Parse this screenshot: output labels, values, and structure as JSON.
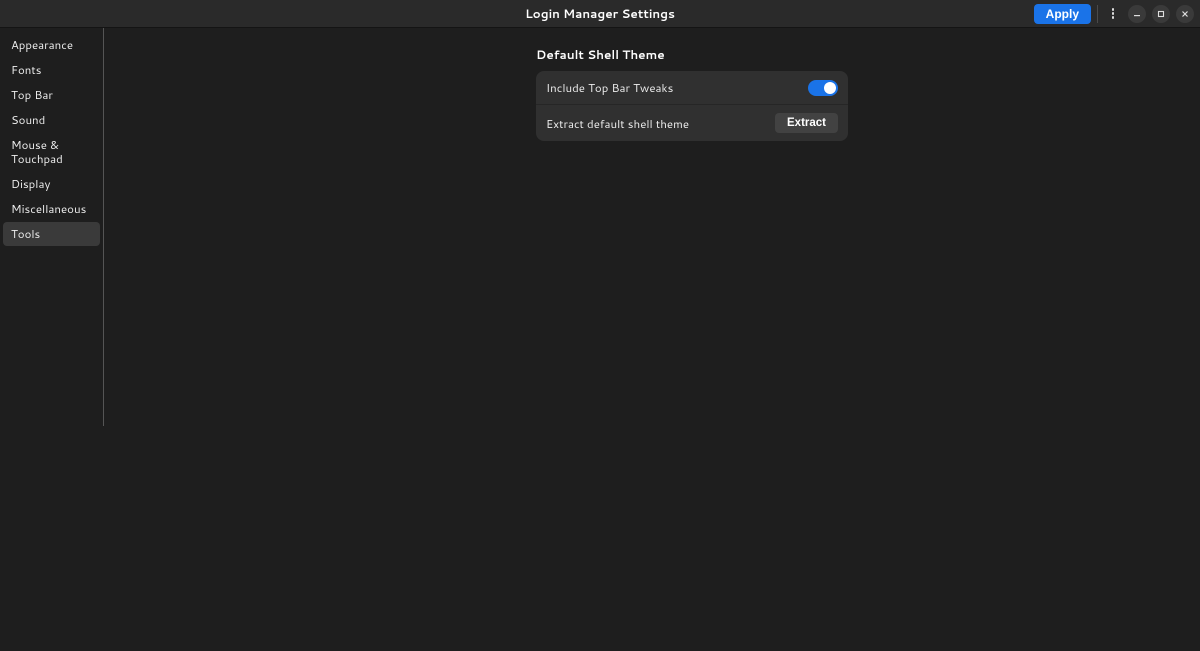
{
  "header": {
    "title": "Login Manager Settings",
    "apply_label": "Apply"
  },
  "sidebar": {
    "items": [
      {
        "label": "Appearance",
        "selected": false
      },
      {
        "label": "Fonts",
        "selected": false
      },
      {
        "label": "Top Bar",
        "selected": false
      },
      {
        "label": "Sound",
        "selected": false
      },
      {
        "label": "Mouse & Touchpad",
        "selected": false
      },
      {
        "label": "Display",
        "selected": false
      },
      {
        "label": "Miscellaneous",
        "selected": false
      },
      {
        "label": "Tools",
        "selected": true
      }
    ]
  },
  "main": {
    "section_title": "Default Shell Theme",
    "rows": {
      "include_top_bar_tweaks": {
        "label": "Include Top Bar Tweaks",
        "toggle_on": true
      },
      "extract_default": {
        "label": "Extract default shell theme",
        "button_label": "Extract"
      }
    }
  },
  "colors": {
    "accent": "#1a73e8",
    "bg": "#1e1e1e",
    "panel": "#303030"
  }
}
